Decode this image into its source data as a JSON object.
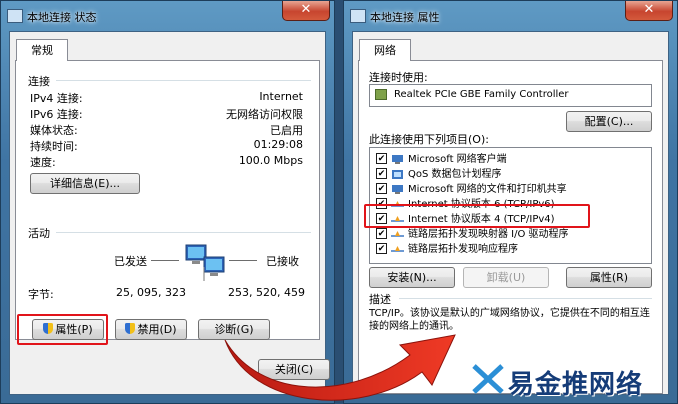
{
  "left_window": {
    "title": "本地连接 状态",
    "close": "✕",
    "tab": "常规",
    "connection": {
      "heading": "连接",
      "rows": [
        {
          "label": "IPv4 连接:",
          "value": "Internet"
        },
        {
          "label": "IPv6 连接:",
          "value": "无网络访问权限"
        },
        {
          "label": "媒体状态:",
          "value": "已启用"
        },
        {
          "label": "持续时间:",
          "value": "01:29:08"
        },
        {
          "label": "速度:",
          "value": "100.0 Mbps"
        }
      ],
      "details_button": "详细信息(E)..."
    },
    "activity": {
      "heading": "活动",
      "sent_label": "已发送",
      "received_label": "已接收",
      "bytes_label": "字节:",
      "bytes_sent": "25, 095, 323",
      "bytes_received": "253, 520, 459"
    },
    "buttons": {
      "properties": "属性(P)",
      "disable": "禁用(D)",
      "diagnose": "诊断(G)",
      "close": "关闭(C)"
    }
  },
  "right_window": {
    "title": "本地连接 属性",
    "close": "✕",
    "tab": "网络",
    "connect_using_label": "连接时使用:",
    "adapter": "Realtek PCIe GBE Family Controller",
    "configure_button": "配置(C)...",
    "items_label": "此连接使用下列项目(O):",
    "items": [
      {
        "text": "Microsoft 网络客户端",
        "checked": true,
        "icon": "network-client-icon"
      },
      {
        "text": "QoS 数据包计划程序",
        "checked": true,
        "icon": "qos-icon"
      },
      {
        "text": "Microsoft 网络的文件和打印机共享",
        "checked": true,
        "icon": "file-share-icon"
      },
      {
        "text": "Internet 协议版本 6 (TCP/IPv6)",
        "checked": true,
        "icon": "protocol-icon"
      },
      {
        "text": "Internet 协议版本 4 (TCP/IPv4)",
        "checked": true,
        "icon": "protocol-icon"
      },
      {
        "text": "链路层拓扑发现映射器 I/O 驱动程序",
        "checked": true,
        "icon": "protocol-icon"
      },
      {
        "text": "链路层拓扑发现响应程序",
        "checked": true,
        "icon": "protocol-icon"
      }
    ],
    "install_button": "安装(N)...",
    "uninstall_button": "卸载(U)",
    "properties_button": "属性(R)",
    "description_heading": "描述",
    "description_text": "TCP/IP。该协议是默认的广域网络协议，它提供在不同的相互连接的网络上的通讯。"
  },
  "watermark": {
    "text": "易金推网络"
  },
  "colors": {
    "highlight": "#e1141a",
    "arrow": "#e0281e",
    "desktop": "#2a4e72"
  }
}
